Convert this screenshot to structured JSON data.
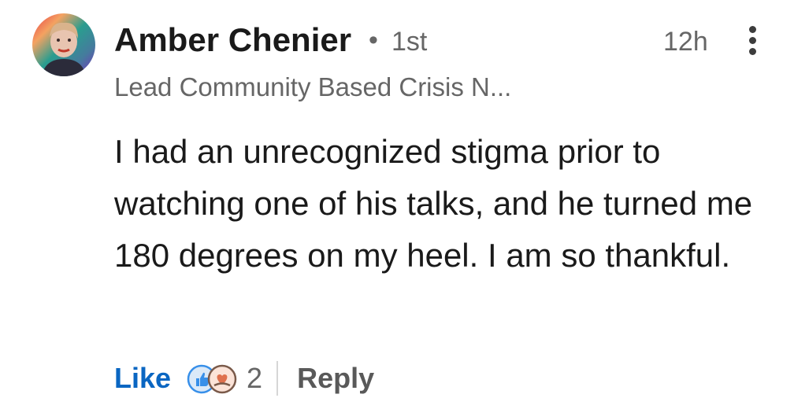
{
  "comment": {
    "author": {
      "name": "Amber Chenier",
      "separator": "•",
      "connection_degree": "1st",
      "headline": "Lead Community Based Crisis N...",
      "avatar_icon": "profile-photo"
    },
    "timestamp": "12h",
    "more_icon": "vertical-ellipsis-icon",
    "text": "I had an unrecognized stigma prior to watching one of his talks, and he turned me 180 degrees on my heel. I am so thankful.",
    "actions": {
      "like_label": "Like",
      "reaction_icons": [
        "like-reaction-icon",
        "love-reaction-icon"
      ],
      "reaction_count": "2",
      "reply_label": "Reply"
    }
  },
  "colors": {
    "like_blue": "#0a66c2",
    "text_primary": "#1a1a1a",
    "text_secondary": "#666666"
  }
}
